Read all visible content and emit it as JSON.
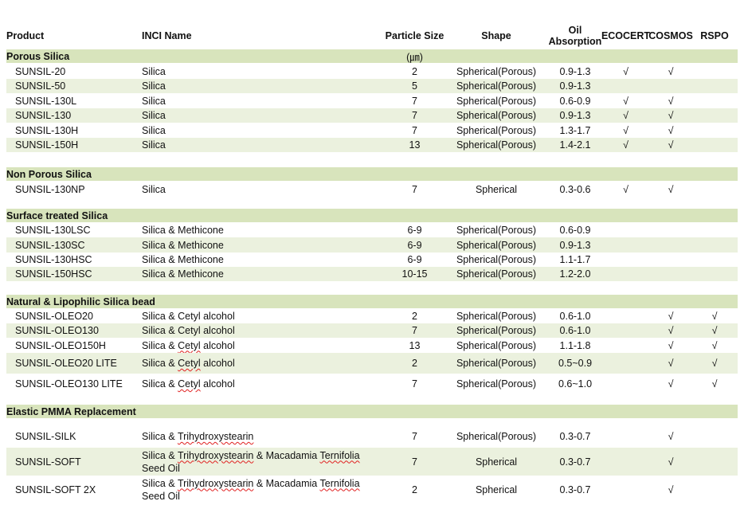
{
  "headers": {
    "product": "Product",
    "inci": "INCI Name",
    "particle_size": "Particle Size",
    "shape": "Shape",
    "oil_absorption_line1": "Oil",
    "oil_absorption_line2": "Absorption",
    "ecocert": "ECOCERT",
    "cosmos": "COSMOS",
    "rspo": "RSPO"
  },
  "unit": "(㎛)",
  "check_mark": "√",
  "sections": [
    {
      "title": "Porous Silica",
      "rows": [
        {
          "product": "SUNSIL-20",
          "inci": [
            "Silica"
          ],
          "size": "2",
          "shape": "Spherical(Porous)",
          "oil": "0.9-1.3",
          "ecocert": true,
          "cosmos": true,
          "rspo": false
        },
        {
          "product": "SUNSIL-50",
          "inci": [
            "Silica"
          ],
          "size": "5",
          "shape": "Spherical(Porous)",
          "oil": "0.9-1.3",
          "ecocert": false,
          "cosmos": false,
          "rspo": false
        },
        {
          "product": "SUNSIL-130L",
          "inci": [
            "Silica"
          ],
          "size": "7",
          "shape": "Spherical(Porous)",
          "oil": "0.6-0.9",
          "ecocert": true,
          "cosmos": true,
          "rspo": false
        },
        {
          "product": "SUNSIL-130",
          "inci": [
            "Silica"
          ],
          "size": "7",
          "shape": "Spherical(Porous)",
          "oil": "0.9-1.3",
          "ecocert": true,
          "cosmos": true,
          "rspo": false
        },
        {
          "product": "SUNSIL-130H",
          "inci": [
            "Silica"
          ],
          "size": "7",
          "shape": "Spherical(Porous)",
          "oil": "1.3-1.7",
          "ecocert": true,
          "cosmos": true,
          "rspo": false
        },
        {
          "product": "SUNSIL-150H",
          "inci": [
            "Silica"
          ],
          "size": "13",
          "shape": "Spherical(Porous)",
          "oil": "1.4-2.1",
          "ecocert": true,
          "cosmos": true,
          "rspo": false
        }
      ]
    },
    {
      "title": "Non Porous Silica",
      "rows": [
        {
          "product": "SUNSIL-130NP",
          "inci": [
            "Silica"
          ],
          "size": "7",
          "shape": "Spherical",
          "oil": "0.3-0.6",
          "ecocert": true,
          "cosmos": true,
          "rspo": false
        }
      ]
    },
    {
      "title": "Surface treated Silica",
      "rows": [
        {
          "product": "SUNSIL-130LSC",
          "inci": [
            "Silica & Methicone"
          ],
          "size": "6-9",
          "shape": "Spherical(Porous)",
          "oil": "0.6-0.9",
          "ecocert": false,
          "cosmos": false,
          "rspo": false
        },
        {
          "product": "SUNSIL-130SC",
          "inci": [
            "Silica & Methicone"
          ],
          "size": "6-9",
          "shape": "Spherical(Porous)",
          "oil": "0.9-1.3",
          "ecocert": false,
          "cosmos": false,
          "rspo": false
        },
        {
          "product": "SUNSIL-130HSC",
          "inci": [
            "Silica & Methicone"
          ],
          "size": "6-9",
          "shape": "Spherical(Porous)",
          "oil": "1.1-1.7",
          "ecocert": false,
          "cosmos": false,
          "rspo": false
        },
        {
          "product": "SUNSIL-150HSC",
          "inci": [
            "Silica & Methicone"
          ],
          "size": "10-15",
          "shape": "Spherical(Porous)",
          "oil": "1.2-2.0",
          "ecocert": false,
          "cosmos": false,
          "rspo": false
        }
      ]
    },
    {
      "title": "Natural & Lipophilic Silica bead",
      "rows": [
        {
          "product": "SUNSIL-OLEO20",
          "inci": [
            "Silica & Cetyl alcohol"
          ],
          "size": "2",
          "shape": "Spherical(Porous)",
          "oil": "0.6-1.0",
          "ecocert": false,
          "cosmos": true,
          "rspo": true
        },
        {
          "product": "SUNSIL-OLEO130",
          "inci": [
            "Silica & Cetyl alcohol"
          ],
          "size": "7",
          "shape": "Spherical(Porous)",
          "oil": "0.6-1.0",
          "ecocert": false,
          "cosmos": true,
          "rspo": true
        },
        {
          "product": "SUNSIL-OLEO150H",
          "inci": [
            "Silica & ",
            "Cetyl",
            " alcohol"
          ],
          "size": "13",
          "shape": "Spherical(Porous)",
          "oil": "1.1-1.8",
          "ecocert": false,
          "cosmos": true,
          "rspo": true
        },
        {
          "product": "SUNSIL-OLEO20 LITE",
          "inci": [
            "Silica & ",
            "Cetyl",
            " alcohol"
          ],
          "size": "2",
          "shape": "Spherical(Porous)",
          "oil": "0.5~0.9",
          "ecocert": false,
          "cosmos": true,
          "rspo": true
        },
        {
          "product": "SUNSIL-OLEO130 LITE",
          "inci": [
            "Silica & ",
            "Cetyl",
            " alcohol"
          ],
          "size": "7",
          "shape": "Spherical(Porous)",
          "oil": "0.6~1.0",
          "ecocert": false,
          "cosmos": true,
          "rspo": true
        }
      ]
    },
    {
      "title": "Elastic PMMA Replacement",
      "rows": [
        {
          "product": "SUNSIL-SILK",
          "inci": [
            "Silica & ",
            "Trihydroxystearin"
          ],
          "size": "7",
          "shape": "Spherical(Porous)",
          "oil": "0.3-0.7",
          "ecocert": false,
          "cosmos": true,
          "rspo": false
        },
        {
          "product": "SUNSIL-SOFT",
          "inci": [
            "Silica & ",
            "Trihydroxystearin",
            " & Macadamia ",
            "Ternifolia",
            " Seed Oil"
          ],
          "size": "7",
          "shape": "Spherical",
          "oil": "0.3-0.7",
          "ecocert": false,
          "cosmos": true,
          "rspo": false
        },
        {
          "product": "SUNSIL-SOFT 2X",
          "inci": [
            "Silica & ",
            "Trihydroxystearin",
            " & Macadamia ",
            "Ternifolia",
            " Seed Oil"
          ],
          "size": "2",
          "shape": "Spherical",
          "oil": "0.3-0.7",
          "ecocert": false,
          "cosmos": true,
          "rspo": false
        }
      ]
    }
  ]
}
